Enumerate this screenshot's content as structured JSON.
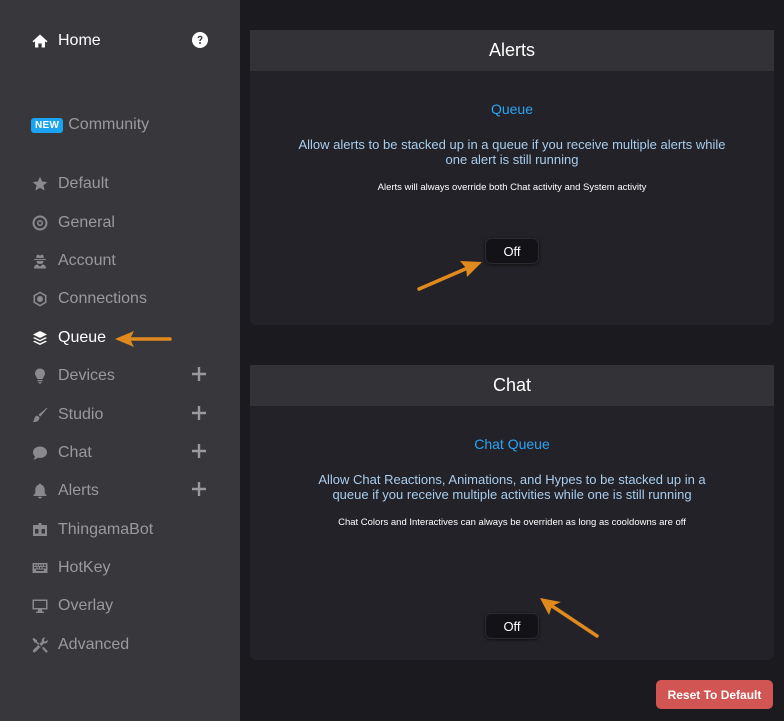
{
  "sidebar": {
    "home_label": "Home",
    "new_badge": "NEW",
    "community_label": "Community",
    "items": [
      {
        "label": "Default",
        "icon": "star-icon"
      },
      {
        "label": "General",
        "icon": "target-icon"
      },
      {
        "label": "Account",
        "icon": "user-secret-icon"
      },
      {
        "label": "Connections",
        "icon": "network-icon"
      },
      {
        "label": "Queue",
        "icon": "layers-icon"
      },
      {
        "label": "Devices",
        "icon": "lightbulb-icon"
      },
      {
        "label": "Studio",
        "icon": "brush-icon"
      },
      {
        "label": "Chat",
        "icon": "chat-bubble-icon"
      },
      {
        "label": "Alerts",
        "icon": "bell-icon"
      },
      {
        "label": "ThingamaBot",
        "icon": "robot-icon"
      },
      {
        "label": "HotKey",
        "icon": "keyboard-icon"
      },
      {
        "label": "Overlay",
        "icon": "monitor-icon"
      },
      {
        "label": "Advanced",
        "icon": "tools-icon"
      }
    ]
  },
  "alerts_panel": {
    "title": "Alerts",
    "subtitle": "Queue",
    "description": "Allow alerts to be stacked up in a queue if you receive multiple alerts while one alert is still running",
    "note": "Alerts will always override both Chat activity and System activity",
    "toggle_label": "Off"
  },
  "chat_panel": {
    "title": "Chat",
    "subtitle": "Chat Queue",
    "description": "Allow Chat Reactions, Animations, and Hypes to be stacked up in a queue if you receive multiple activities while one is still running",
    "note": "Chat Colors and Interactives can always be overriden as long as cooldowns are off",
    "toggle_label": "Off"
  },
  "reset_label": "Reset To Default",
  "colors": {
    "accent_blue": "#2aa4f4",
    "annotation_arrow": "#e08a1e",
    "reset_red": "#d15553"
  }
}
